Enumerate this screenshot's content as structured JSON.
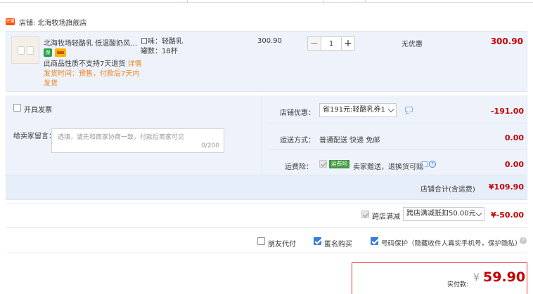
{
  "shop": {
    "icon_text": "天猫",
    "name": "店铺: 北海牧场旗舰店"
  },
  "item": {
    "title": "北海牧场轻酪乳 低温酸奶风味…",
    "badge_text": "保",
    "notice_line1": "此商品性质不支持7天退货",
    "notice_detail": "详情",
    "notice_line2": "发货时间：预售，付款后7天内发货",
    "spec_flavor": "口味：轻酪乳",
    "spec_count": "罐数：18杯",
    "unit_price": "300.90",
    "qty_minus": "−",
    "qty_value": "1",
    "qty_plus": "+",
    "discount": "无优惠",
    "total": "300.90"
  },
  "options": {
    "invoice_label": "开具发票",
    "memo_label": "给卖家留言：",
    "memo_placeholder": "选填，请先和商家协商一致，付款后商家可见",
    "memo_count": "0/200",
    "shop_discount_label": "店铺优惠：",
    "shop_discount_select": "省191元:轻酪乳券1",
    "shop_discount_value": "-191.00",
    "shipping_label": "运送方式：",
    "shipping_text": "普通配送 快递 免邮",
    "shipping_value": "0.00",
    "insurance_label": "运费险：",
    "insurance_tag": "运费险",
    "insurance_text": "卖家赠送，退换货可赔",
    "insurance_value": "0.00"
  },
  "subtotal": {
    "label": "店铺合计(含运费)",
    "value": "¥109.90"
  },
  "cross_store": {
    "label": "跨店满减",
    "select": "跨店满减抵扣50.00元",
    "value": "¥-50.00"
  },
  "checkboxes": {
    "friend_pay": "朋友代付",
    "anonymous": "匿名购买",
    "number_protect": "号码保护（隐藏收件人真实手机号，保护隐私）"
  },
  "payment": {
    "label": "实付款:",
    "currency": "¥",
    "amount": "59.90"
  },
  "colors": {
    "accent": "#c40000",
    "panel": "#eef3fb",
    "checkbox": "#3a7dd8"
  }
}
